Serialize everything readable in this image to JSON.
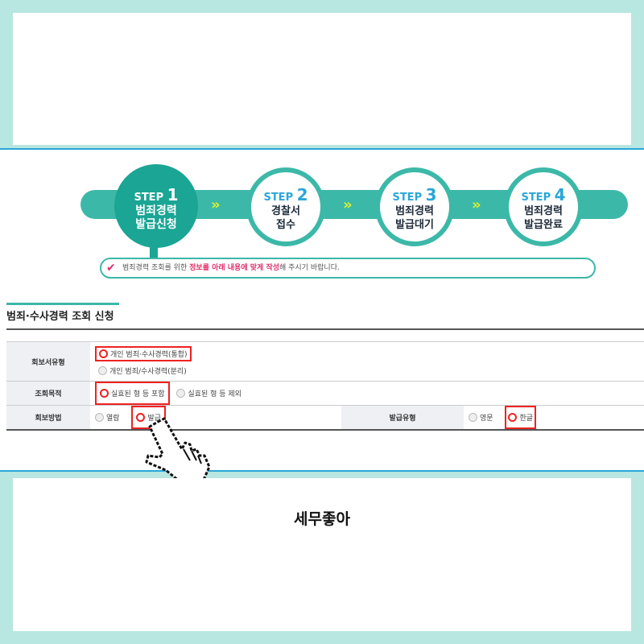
{
  "caption": "세무좋아",
  "steps": [
    {
      "step": "STEP",
      "num": "1",
      "line1": "범죄경력",
      "line2": "발급신청",
      "active": true
    },
    {
      "step": "STEP",
      "num": "2",
      "line1": "경찰서",
      "line2": "접수",
      "active": false
    },
    {
      "step": "STEP",
      "num": "3",
      "line1": "범죄경력",
      "line2": "발급대기",
      "active": false
    },
    {
      "step": "STEP",
      "num": "4",
      "line1": "범죄경력",
      "line2": "발급완료",
      "active": false
    }
  ],
  "chevron": "»",
  "notice": {
    "pre": "범죄경력 조회를 위한 ",
    "highlight": "정보를 아래 내용에 맞게 작성",
    "post": "해 주시기 바랍니다."
  },
  "form": {
    "title": "범죄·수사경력 조회 신청",
    "rows": {
      "report_type": {
        "label": "회보서유형",
        "options": [
          "개인 범죄·수사경력(통합)",
          "개인 범죄/수사경력(분리)"
        ]
      },
      "purpose": {
        "label": "조회목적",
        "options": [
          "실효된 형 등 포함",
          "실효된 형 등 제외"
        ]
      },
      "method": {
        "label": "회보방법",
        "options": [
          "열람",
          "발급"
        ]
      },
      "issue_type": {
        "label": "발급유형",
        "options": [
          "영문",
          "한글"
        ]
      }
    }
  },
  "colors": {
    "teal": "#3cb8a8",
    "active_teal": "#1aa594",
    "highlight": "#e0306a",
    "chevron": "#d6f22e"
  }
}
